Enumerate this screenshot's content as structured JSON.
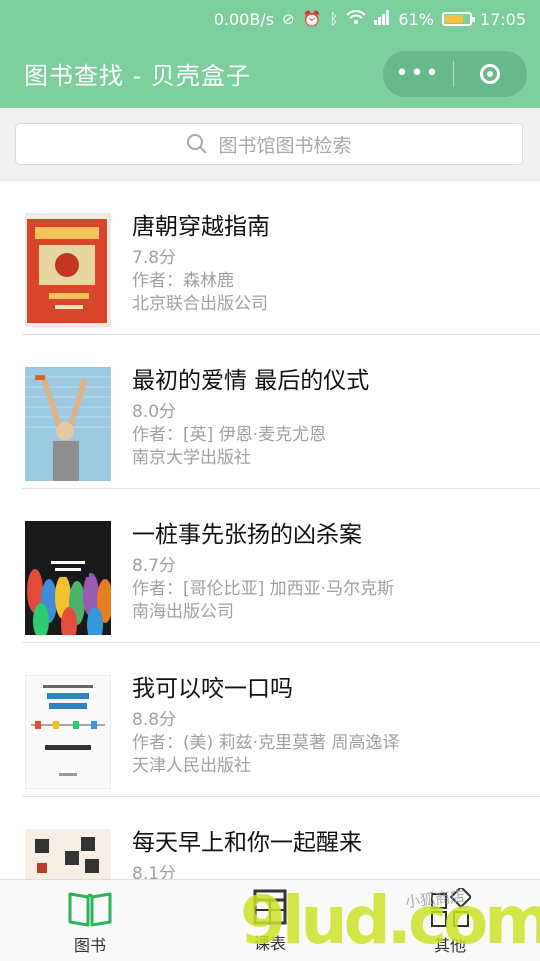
{
  "status_bar": {
    "network_speed": "0.00B/s",
    "battery_percent": "61%",
    "time": "17:05"
  },
  "header": {
    "title": "图书查找 - 贝壳盒子",
    "more_icon": "more-dots-icon",
    "close_icon": "target-close-icon"
  },
  "search": {
    "placeholder": "图书馆图书检索"
  },
  "books": [
    {
      "title": "唐朝穿越指南",
      "score": "7.8分",
      "author": "作者：森林鹿",
      "publisher": "北京联合出版公司"
    },
    {
      "title": "最初的爱情 最后的仪式",
      "score": "8.0分",
      "author": "作者：[英] 伊恩·麦克尤恩",
      "publisher": "南京大学出版社"
    },
    {
      "title": "一桩事先张扬的凶杀案",
      "score": "8.7分",
      "author": "作者：[哥伦比亚] 加西亚·马尔克斯",
      "publisher": "南海出版公司"
    },
    {
      "title": "我可以咬一口吗",
      "score": "8.8分",
      "author": "作者：(美) 莉兹·克里莫著 周高逸译",
      "publisher": "天津人民出版社"
    },
    {
      "title": "每天早上和你一起醒来",
      "score": "8.1分",
      "author": "",
      "publisher": ""
    }
  ],
  "tabs": [
    {
      "label": "图书",
      "icon": "book-icon"
    },
    {
      "label": "课表",
      "icon": "timetable-icon"
    },
    {
      "label": "其他",
      "icon": "grid-icon"
    }
  ],
  "watermark": {
    "text": "9lud.com",
    "tag": "小狐商店"
  },
  "colors": {
    "brand": "#7dd09e",
    "tab_active": "#2fb257"
  }
}
